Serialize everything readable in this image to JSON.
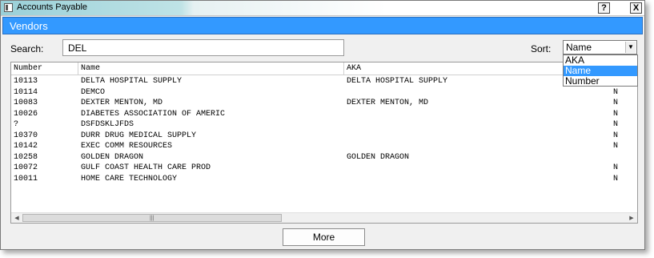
{
  "window": {
    "title": "Accounts Payable",
    "help_label": "?",
    "close_label": "X"
  },
  "header": {
    "title": "Vendors"
  },
  "search": {
    "label": "Search:",
    "value": "DEL"
  },
  "sort": {
    "label": "Sort:",
    "selected": "Name",
    "options": [
      "AKA",
      "Name",
      "Number"
    ]
  },
  "table": {
    "columns": [
      "Number",
      "Name",
      "AKA"
    ],
    "rows": [
      {
        "number": "10113",
        "name": "DELTA HOSPITAL SUPPLY",
        "aka": "DELTA HOSPITAL SUPPLY",
        "flag": ""
      },
      {
        "number": "10114",
        "name": "DEMCO",
        "aka": "",
        "flag": "N"
      },
      {
        "number": "10083",
        "name": "DEXTER MENTON, MD",
        "aka": "DEXTER MENTON, MD",
        "flag": "N"
      },
      {
        "number": "10026",
        "name": "DIABETES ASSOCIATION OF AMERIC",
        "aka": "",
        "flag": "N"
      },
      {
        "number": "?",
        "name": "DSFDSKLJFDS",
        "aka": "",
        "flag": "N"
      },
      {
        "number": "10370",
        "name": "DURR DRUG MEDICAL SUPPLY",
        "aka": "",
        "flag": "N"
      },
      {
        "number": "10142",
        "name": "EXEC COMM RESOURCES",
        "aka": "",
        "flag": "N"
      },
      {
        "number": "10258",
        "name": "GOLDEN DRAGON",
        "aka": "GOLDEN DRAGON",
        "flag": ""
      },
      {
        "number": "10072",
        "name": "GULF COAST HEALTH CARE PROD",
        "aka": "",
        "flag": "N"
      },
      {
        "number": "10011",
        "name": "HOME CARE TECHNOLOGY",
        "aka": "",
        "flag": "N"
      }
    ]
  },
  "buttons": {
    "more": "More"
  },
  "colors": {
    "header_bar": "#3399ff",
    "selection": "#3399ff"
  }
}
